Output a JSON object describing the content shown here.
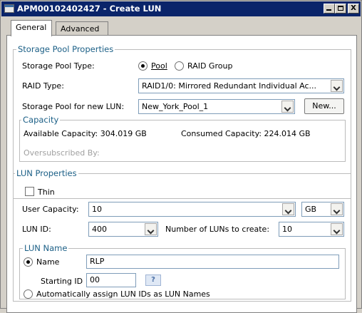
{
  "window": {
    "title": "APM00102402427 - Create LUN",
    "controls": {
      "minimize": "_",
      "maximize": "□",
      "close": "X"
    }
  },
  "tabs": [
    {
      "label": "General",
      "active": true
    },
    {
      "label": "Advanced",
      "active": false
    }
  ],
  "storage_pool_properties": {
    "legend": "Storage Pool Properties",
    "pool_type_label": "Storage Pool Type:",
    "pool_option": "Pool",
    "raid_group_option": "RAID Group",
    "pool_type_selected": "Pool",
    "raid_type_label": "RAID Type:",
    "raid_type_value": "RAID1/0: Mirrored Redundant Individual Ac...",
    "pool_for_lun_label": "Storage Pool for new LUN:",
    "pool_for_lun_value": "New_York_Pool_1",
    "new_button": "New...",
    "capacity": {
      "legend": "Capacity",
      "available": "Available Capacity: 304.019 GB",
      "consumed": "Consumed Capacity: 224.014 GB",
      "oversubscribed": "Oversubscribed By:"
    }
  },
  "lun_properties": {
    "legend": "LUN Properties",
    "thin_label": "Thin",
    "thin_checked": false,
    "user_capacity_label": "User Capacity:",
    "user_capacity_value": "10",
    "unit_value": "GB",
    "lun_id_label": "LUN ID:",
    "lun_id_value": "400",
    "num_luns_label": "Number of LUNs to create:",
    "num_luns_value": "10",
    "lun_name": {
      "legend": "LUN Name",
      "name_option": "Name",
      "name_selected": true,
      "name_value": "RLP",
      "starting_id_label": "Starting ID",
      "starting_id_value": "00",
      "help_icon": "?",
      "auto_assign_option": "Automatically assign LUN IDs as LUN Names"
    }
  },
  "colors": {
    "titlebar": "#0a246a",
    "legend_text": "#1b5f86",
    "panel": "#ffffff",
    "chrome": "#d4d0c8"
  }
}
